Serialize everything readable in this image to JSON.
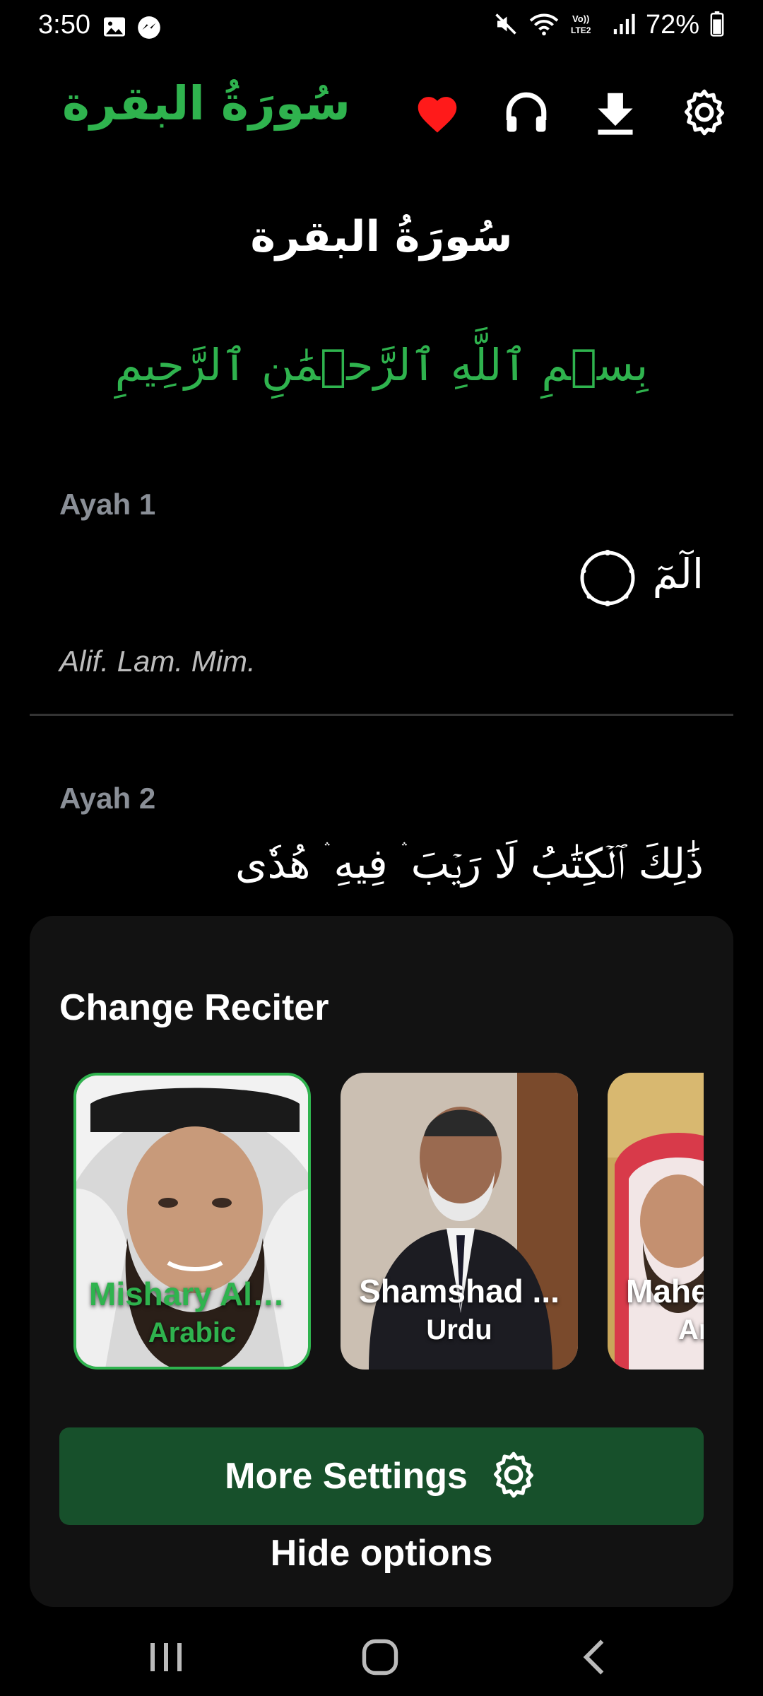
{
  "status_bar": {
    "time": "3:50",
    "battery": "72%",
    "icons": [
      "gallery-icon",
      "messenger-icon",
      "mute-icon",
      "wifi-icon",
      "volte-icon",
      "signal-icon",
      "battery-icon"
    ]
  },
  "app_bar": {
    "title": "سُورَةُ البقرة",
    "actions": [
      "heart-icon",
      "headphones-icon",
      "download-icon",
      "settings-icon"
    ]
  },
  "content": {
    "surah_heading": "سُورَةُ البقرة",
    "bismillah": "بِسۡمِ ٱللَّهِ ٱلرَّحۡمَٰنِ ٱلرَّحِيمِ",
    "ayahs": [
      {
        "label": "Ayah 1",
        "arabic": "الٓمٓ",
        "translation": "Alif. Lam. Mim."
      },
      {
        "label": "Ayah 2",
        "arabic": "ذَٰلِكَ ٱلۡكِتَٰبُ لَا رَيۡبَ ۛ فِيهِ ۛ هُدٗى"
      }
    ]
  },
  "sheet": {
    "title": "Change Reciter",
    "reciters": [
      {
        "name": "Mishary Ala...",
        "language": "Arabic",
        "selected": true
      },
      {
        "name": "Shamshad ...",
        "language": "Urdu",
        "selected": false
      },
      {
        "name": "Mahe",
        "language": "Ar",
        "selected": false
      }
    ],
    "more_settings_label": "More Settings",
    "hide_options_label": "Hide options"
  },
  "colors": {
    "accent": "#2fb34e",
    "background": "#000000",
    "sheet": "#121212",
    "button": "#17502b",
    "heart": "#ff1a1a",
    "muted_label": "#8a8f97"
  }
}
